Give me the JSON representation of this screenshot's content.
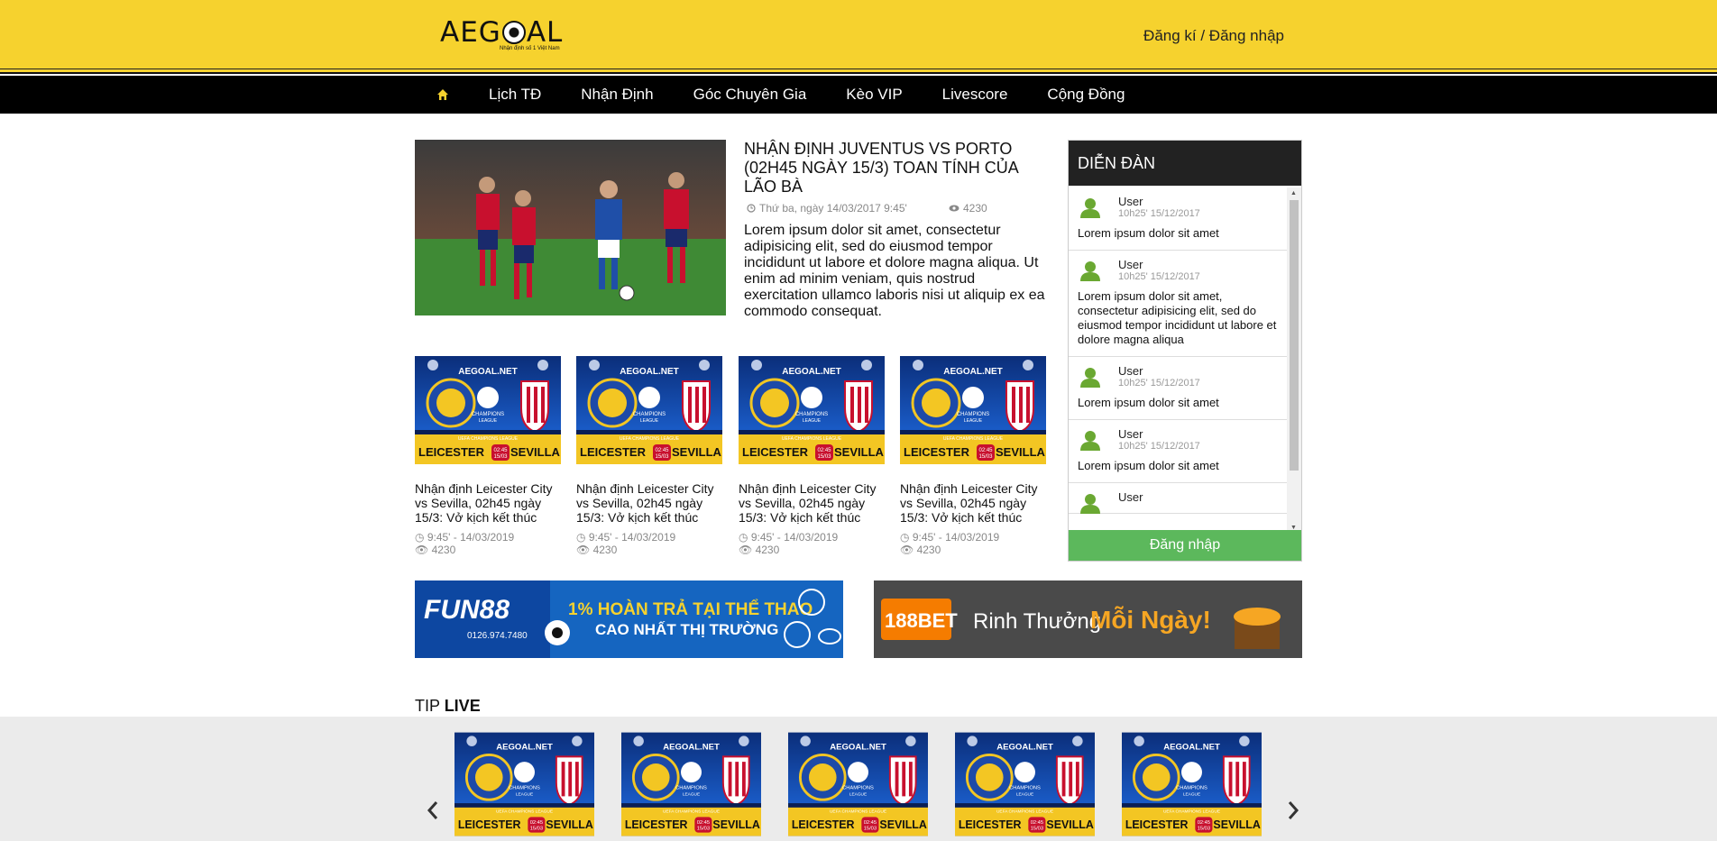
{
  "header": {
    "logo_text": "AEGOAL",
    "logo_sub": "Nhận định số 1 Việt Nam",
    "auth": "Đăng kí / Đăng nhập"
  },
  "nav": {
    "home_icon": "home-icon",
    "items": [
      "Lịch TĐ",
      "Nhận Định",
      "Góc Chuyên Gia",
      "Kèo VIP",
      "Livescore",
      "Cộng Đồng"
    ]
  },
  "featured": {
    "title": "NHẬN ĐỊNH JUVENTUS VS PORTO (02H45 NGÀY 15/3) TOAN TÍNH CỦA LÃO BÀ",
    "date": "Thứ ba, ngày 14/03/2017 9:45'",
    "views": "4230",
    "description": "Lorem ipsum dolor sit amet, consectetur adipisicing elit, sed do eiusmod tempor incididunt ut labore et dolore magna aliqua. Ut enim ad minim veniam, quis nostrud exercitation ullamco laboris nisi ut aliquip ex ea commodo consequat."
  },
  "cards": [
    {
      "title": "Nhận định Leicester City vs Sevilla, 02h45 ngày 15/3: Vở kịch kết thúc",
      "time": "9:45' - 14/03/2019",
      "views": "4230"
    },
    {
      "title": "Nhận định Leicester City vs Sevilla, 02h45 ngày 15/3: Vở kịch kết thúc",
      "time": "9:45' - 14/03/2019",
      "views": "4230"
    },
    {
      "title": "Nhận định Leicester City vs Sevilla, 02h45 ngày 15/3: Vở kịch kết thúc",
      "time": "9:45' - 14/03/2019",
      "views": "4230"
    },
    {
      "title": "Nhận định Leicester City vs Sevilla, 02h45 ngày 15/3: Vở kịch kết thúc",
      "time": "9:45' - 14/03/2019",
      "views": "4230"
    }
  ],
  "thumb_text": {
    "brand": "AEGOAL.NET",
    "league_1": "CHAMPIONS",
    "league_2": "LEAGUE",
    "league_full": "UEFA CHAMPIONS LEAGUE",
    "team_home": "LEICESTER",
    "team_away": "SEVILLA",
    "kickoff_time": "02:45",
    "kickoff_date": "15/03"
  },
  "forum": {
    "title": "DIỄN ĐÀN",
    "posts": [
      {
        "user": "User",
        "time": "10h25' 15/12/2017",
        "text": "Lorem ipsum dolor sit amet"
      },
      {
        "user": "User",
        "time": "10h25' 15/12/2017",
        "text": "Lorem ipsum dolor sit amet, consectetur adipisicing elit, sed do eiusmod tempor incididunt ut labore et dolore magna aliqua"
      },
      {
        "user": "User",
        "time": "10h25' 15/12/2017",
        "text": "Lorem ipsum dolor sit amet"
      },
      {
        "user": "User",
        "time": "10h25' 15/12/2017",
        "text": "Lorem ipsum dolor sit amet"
      },
      {
        "user": "User",
        "time": "",
        "text": ""
      }
    ],
    "login": "Đăng nhập"
  },
  "banners": {
    "fun88": {
      "brand": "FUN88",
      "line1": "1% HOÀN TRẢ TẠI THỂ THAO",
      "line2": "CAO NHẤT THỊ TRƯỜNG",
      "phone": "0126.974.7480"
    },
    "bet188": {
      "brand": "188BET",
      "text1": "Rinh Thưởng",
      "text2": "Mỗi Ngày!"
    }
  },
  "tip_live": {
    "title_light": "TIP ",
    "title_bold": "LIVE",
    "count": 5
  },
  "colors": {
    "header_yellow": "#f6d22e",
    "nav_black": "#000000",
    "login_green": "#5cb85c",
    "forum_head": "#222222"
  }
}
